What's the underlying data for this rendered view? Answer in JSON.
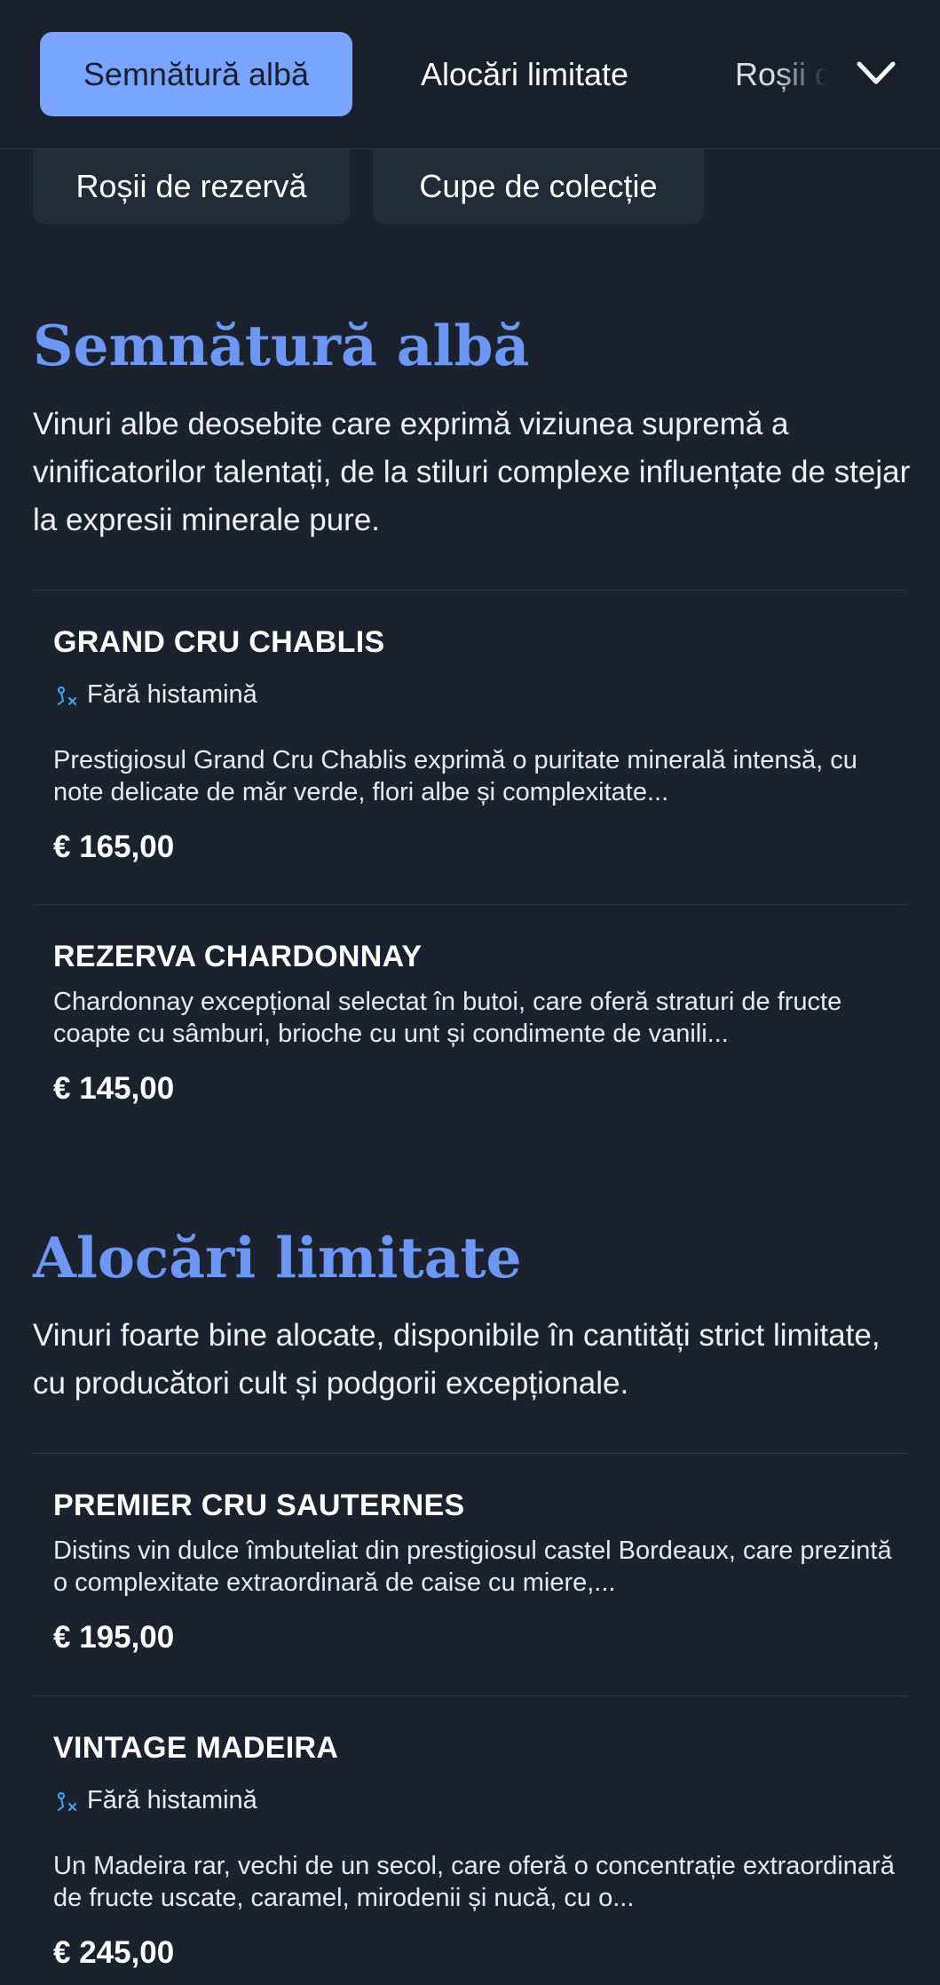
{
  "nav": {
    "tabs": [
      {
        "label": "Semnătură albă",
        "active": true
      },
      {
        "label": "Alocări limitate",
        "active": false
      },
      {
        "label": "Roșii de rezervă",
        "active": false
      }
    ],
    "expand_icon": "chevron-down-icon"
  },
  "categories_overflow": [
    {
      "label": "Roșii de rezervă"
    },
    {
      "label": "Cupe de colecție"
    }
  ],
  "sections": [
    {
      "title": "Semnătură albă",
      "description": "Vinuri albe deosebite care exprimă viziunea supremă a vinificatorilor talentați, de la stiluri complexe influențate de stejar la expresii minerale pure.",
      "items": [
        {
          "name": "GRAND CRU CHABLIS",
          "badge": "Fără histamină",
          "badge_icon": "histamine-free-icon",
          "description": "Prestigiosul Grand Cru Chablis exprimă o puritate minerală intensă, cu note delicate de măr verde, flori albe și complexitate...",
          "price": "€ 165,00"
        },
        {
          "name": "REZERVA CHARDONNAY",
          "badge": null,
          "description": "Chardonnay excepțional selectat în butoi, care oferă straturi de fructe coapte cu sâmburi, brioche cu unt și condimente de vanili...",
          "price": "€ 145,00"
        }
      ]
    },
    {
      "title": "Alocări limitate",
      "description": "Vinuri foarte bine alocate, disponibile în cantități strict limitate, cu producători cult și podgorii excepționale.",
      "items": [
        {
          "name": "PREMIER CRU SAUTERNES",
          "badge": null,
          "description": "Distins vin dulce îmbuteliat din prestigiosul castel Bordeaux, care prezintă o complexitate extraordinară de caise cu miere,...",
          "price": "€ 195,00"
        },
        {
          "name": "VINTAGE MADEIRA",
          "badge": "Fără histamină",
          "badge_icon": "histamine-free-icon",
          "description": "Un Madeira rar, vechi de un secol, care oferă o concentrație extraordinară de fructe uscate, caramel, mirodenii și nucă, cu o...",
          "price": "€ 245,00"
        }
      ]
    }
  ],
  "colors": {
    "background": "#1c222d",
    "accent": "#79a4ff",
    "heading": "#6c97f4",
    "badge_icon": "#3fa9f5"
  }
}
